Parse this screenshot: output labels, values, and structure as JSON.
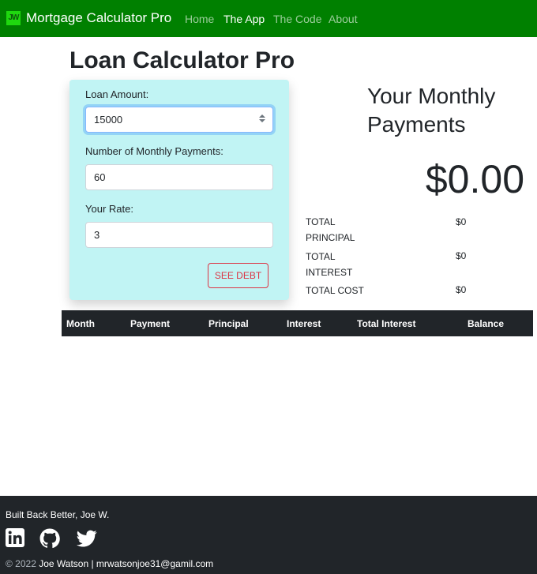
{
  "navbar": {
    "logo_text": "JW",
    "brand": "Mortgage Calculator Pro",
    "links": [
      {
        "label": "Home",
        "active": false
      },
      {
        "label": "The App",
        "active": true
      },
      {
        "label": "The Code",
        "active": false
      },
      {
        "label": "About",
        "active": false
      }
    ],
    "background": "#008000"
  },
  "page": {
    "title": "Loan Calculator Pro"
  },
  "form": {
    "background": "#c1f4f4",
    "loan_amount_label": "Loan Amount:",
    "loan_amount_value": "15000",
    "payments_label": "Number of Monthly Payments:",
    "payments_value": "60",
    "rate_label": "Your Rate:",
    "rate_value": "3",
    "button_label": "SEE DEBT"
  },
  "results": {
    "heading": "Your Monthly Payments",
    "monthly_payment": "$0.00",
    "summary": [
      {
        "label": "TOTAL PRINCIPAL",
        "value": "$0"
      },
      {
        "label": "TOTAL INTEREST",
        "value": "$0"
      },
      {
        "label": "TOTAL COST",
        "value": "$0"
      }
    ]
  },
  "table": {
    "columns": [
      "Month",
      "Payment",
      "Principal",
      "Interest",
      "Total Interest",
      "Balance"
    ]
  },
  "footer": {
    "tagline": "Built Back Better, Joe W.",
    "social_icons": [
      "linkedin-icon",
      "github-icon",
      "twitter-icon"
    ],
    "copyright_prefix": "© 2022",
    "author": "Joe Watson | mrwatsonjoe31@gamil.com"
  }
}
